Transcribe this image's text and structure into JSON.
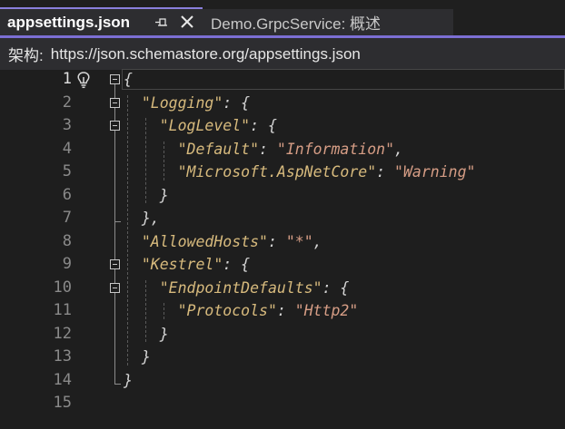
{
  "tabs": {
    "active_label": "appsettings.json",
    "inactive_label": "Demo.GrpcService: 概述"
  },
  "schema": {
    "label": "架构:",
    "url": "https://json.schemastore.org/appsettings.json"
  },
  "editor": {
    "current_line": 1,
    "line_numbers": [
      "1",
      "2",
      "3",
      "4",
      "5",
      "6",
      "7",
      "8",
      "9",
      "10",
      "11",
      "12",
      "13",
      "14",
      "15"
    ],
    "lines": [
      {
        "tokens": [
          {
            "t": "p",
            "v": "{"
          }
        ]
      },
      {
        "tokens": [
          {
            "t": "p",
            "v": "  "
          },
          {
            "t": "k",
            "v": "\"Logging\""
          },
          {
            "t": "p",
            "v": ": {"
          }
        ]
      },
      {
        "tokens": [
          {
            "t": "p",
            "v": "    "
          },
          {
            "t": "k",
            "v": "\"LogLevel\""
          },
          {
            "t": "p",
            "v": ": {"
          }
        ]
      },
      {
        "tokens": [
          {
            "t": "p",
            "v": "      "
          },
          {
            "t": "k",
            "v": "\"Default\""
          },
          {
            "t": "p",
            "v": ": "
          },
          {
            "t": "s",
            "v": "\"Information\""
          },
          {
            "t": "p",
            "v": ","
          }
        ]
      },
      {
        "tokens": [
          {
            "t": "p",
            "v": "      "
          },
          {
            "t": "k",
            "v": "\"Microsoft.AspNetCore\""
          },
          {
            "t": "p",
            "v": ": "
          },
          {
            "t": "s",
            "v": "\"Warning\""
          }
        ]
      },
      {
        "tokens": [
          {
            "t": "p",
            "v": "    }"
          }
        ]
      },
      {
        "tokens": [
          {
            "t": "p",
            "v": "  },"
          }
        ]
      },
      {
        "tokens": [
          {
            "t": "p",
            "v": "  "
          },
          {
            "t": "k",
            "v": "\"AllowedHosts\""
          },
          {
            "t": "p",
            "v": ": "
          },
          {
            "t": "s",
            "v": "\"*\""
          },
          {
            "t": "p",
            "v": ","
          }
        ]
      },
      {
        "tokens": [
          {
            "t": "p",
            "v": "  "
          },
          {
            "t": "k",
            "v": "\"Kestrel\""
          },
          {
            "t": "p",
            "v": ": {"
          }
        ]
      },
      {
        "tokens": [
          {
            "t": "p",
            "v": "    "
          },
          {
            "t": "k",
            "v": "\"EndpointDefaults\""
          },
          {
            "t": "p",
            "v": ": {"
          }
        ]
      },
      {
        "tokens": [
          {
            "t": "p",
            "v": "      "
          },
          {
            "t": "k",
            "v": "\"Protocols\""
          },
          {
            "t": "p",
            "v": ": "
          },
          {
            "t": "s",
            "v": "\"Http2\""
          }
        ]
      },
      {
        "tokens": [
          {
            "t": "p",
            "v": "    }"
          }
        ]
      },
      {
        "tokens": [
          {
            "t": "p",
            "v": "  }"
          }
        ]
      },
      {
        "tokens": [
          {
            "t": "p",
            "v": "}"
          }
        ]
      },
      {
        "tokens": []
      }
    ]
  },
  "icons": {
    "pin": "pin-icon",
    "close": "close-icon",
    "lightbulb": "lightbulb-icon"
  }
}
